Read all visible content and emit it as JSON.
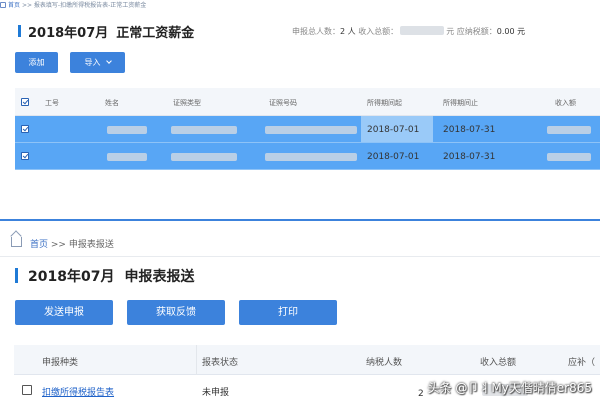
{
  "top": {
    "breadcrumb": {
      "home": "首页",
      "sep": ">>",
      "path": "报表填写-扣缴所得税报告表-正常工资薪金"
    },
    "title": {
      "period": "2018年07月",
      "name": "正常工资薪金"
    },
    "stats": {
      "people_label": "申报总人数：",
      "people_value": "2 人",
      "income_label": "收入总额：",
      "income_unit": "元",
      "tax_label": "应纳税额：",
      "tax_value": "0.00 元"
    },
    "buttons": {
      "add": "添加",
      "import": "导入"
    },
    "table": {
      "headers": [
        "工号",
        "姓名",
        "证照类型",
        "证照号码",
        "所得期间起",
        "所得期间止",
        "收入额"
      ],
      "rows": [
        {
          "start": "2018-07-01",
          "end": "2018-07-31"
        },
        {
          "start": "2018-07-01",
          "end": "2018-07-31"
        }
      ]
    }
  },
  "bottom": {
    "breadcrumb": {
      "home": "首页",
      "sep": ">>",
      "current": "申报表报送"
    },
    "title": {
      "period": "2018年07月",
      "name": "申报表报送"
    },
    "buttons": {
      "submit": "发送申报",
      "feedback": "获取反馈",
      "print": "打印"
    },
    "table": {
      "headers": [
        "申报种类",
        "报表状态",
        "纳税人数",
        "收入总额",
        "应补（"
      ],
      "rows": [
        {
          "type": "扣缴所得税报告表",
          "status": "未申报",
          "count": "2"
        }
      ]
    }
  },
  "watermark": "头条 @卩丬My天偕晴倩er865"
}
